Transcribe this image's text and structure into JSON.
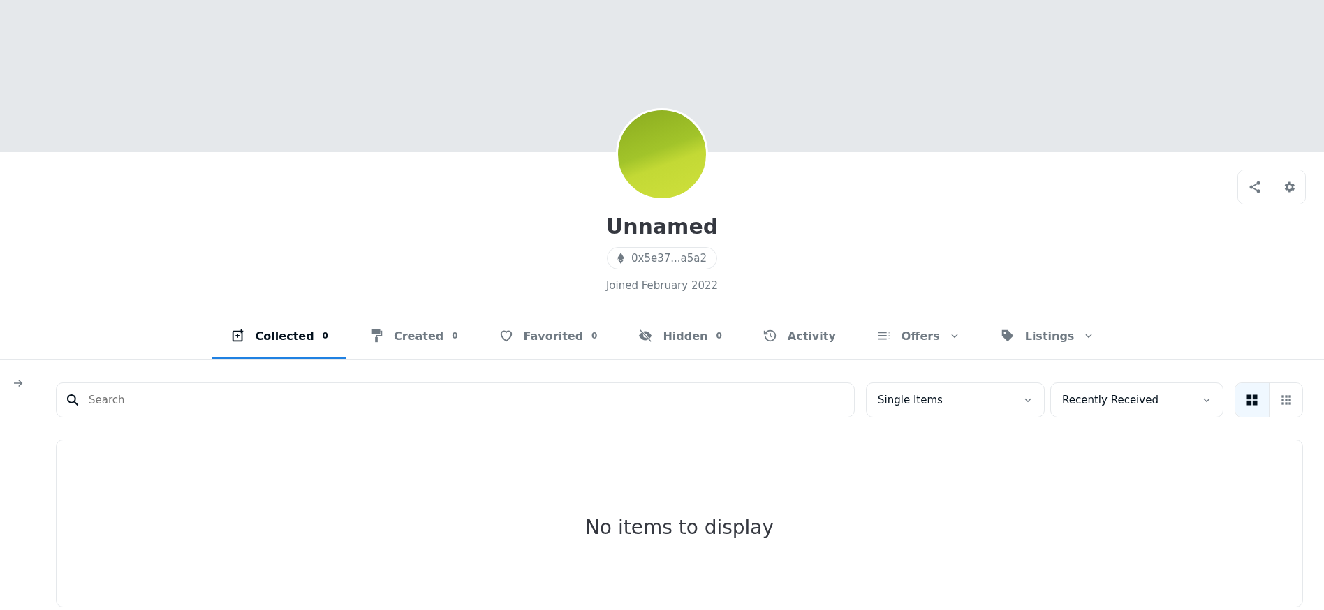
{
  "profile": {
    "name": "Unnamed",
    "address": "0x5e37...a5a2",
    "joined": "Joined February 2022"
  },
  "tabs": [
    {
      "kind": "collected",
      "label": "Collected",
      "count": "0",
      "selected": true
    },
    {
      "kind": "created",
      "label": "Created",
      "count": "0",
      "selected": false
    },
    {
      "kind": "favorited",
      "label": "Favorited",
      "count": "0",
      "selected": false
    },
    {
      "kind": "hidden",
      "label": "Hidden",
      "count": "0",
      "selected": false
    },
    {
      "kind": "activity",
      "label": "Activity",
      "selected": false
    },
    {
      "kind": "offers",
      "label": "Offers",
      "dropdown": true,
      "selected": false
    },
    {
      "kind": "listings",
      "label": "Listings",
      "dropdown": true,
      "selected": false
    }
  ],
  "search": {
    "placeholder": "Search"
  },
  "filters": [
    {
      "value": "Single Items"
    },
    {
      "value": "Recently Received"
    }
  ],
  "view_toggle": [
    {
      "kind": "large",
      "selected": true
    },
    {
      "kind": "small",
      "selected": false
    }
  ],
  "empty_message": "No items to display"
}
